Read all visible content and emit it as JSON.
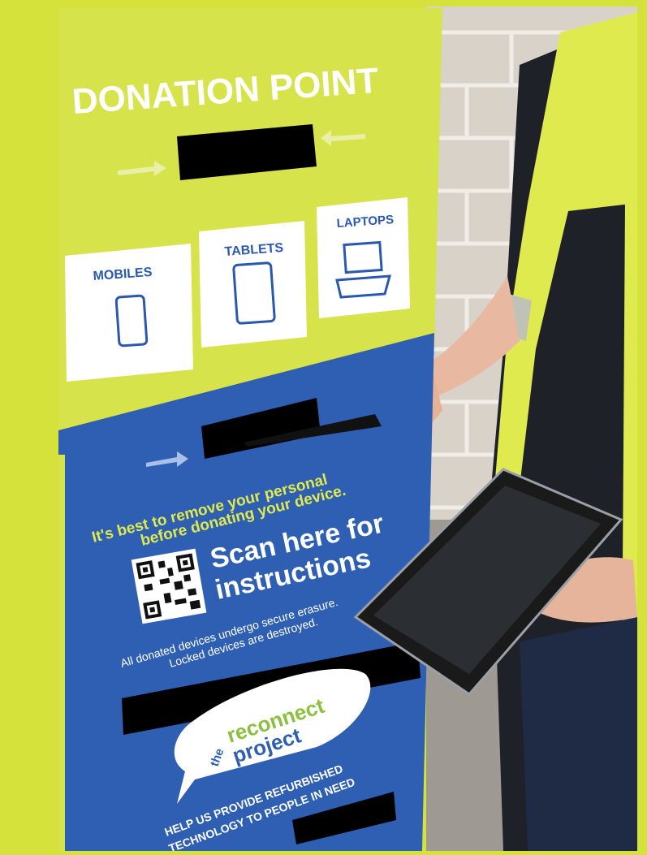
{
  "box": {
    "header": "DONATION POINT",
    "categories": [
      {
        "label": "MOBILES",
        "icon": "mobile-phone-icon"
      },
      {
        "label": "TABLETS",
        "icon": "tablet-icon"
      },
      {
        "label": "LAPTOPS",
        "icon": "laptop-icon"
      }
    ],
    "notice_line_1": "It's best to remove your personal",
    "notice_line_2": "before donating your device.",
    "scan_line_1": "Scan here for",
    "scan_line_2": "instructions",
    "disclaimer_line_1": "All donated devices undergo secure erasure.",
    "disclaimer_line_2": "Locked devices are destroyed.",
    "logo": {
      "line_1": "the",
      "line_2": "reconnect",
      "line_3": "project"
    },
    "tagline_line_1": "HELP US PROVIDE REFURBISHED",
    "tagline_line_2": "TECHNOLOGY TO PEOPLE IN NEED"
  },
  "colors": {
    "frame": "#d4e23b",
    "box_yellow": "#d6e34a",
    "box_blue": "#2f5fb3",
    "wall": "#d9d4cc",
    "vest": "#dfea4f"
  }
}
